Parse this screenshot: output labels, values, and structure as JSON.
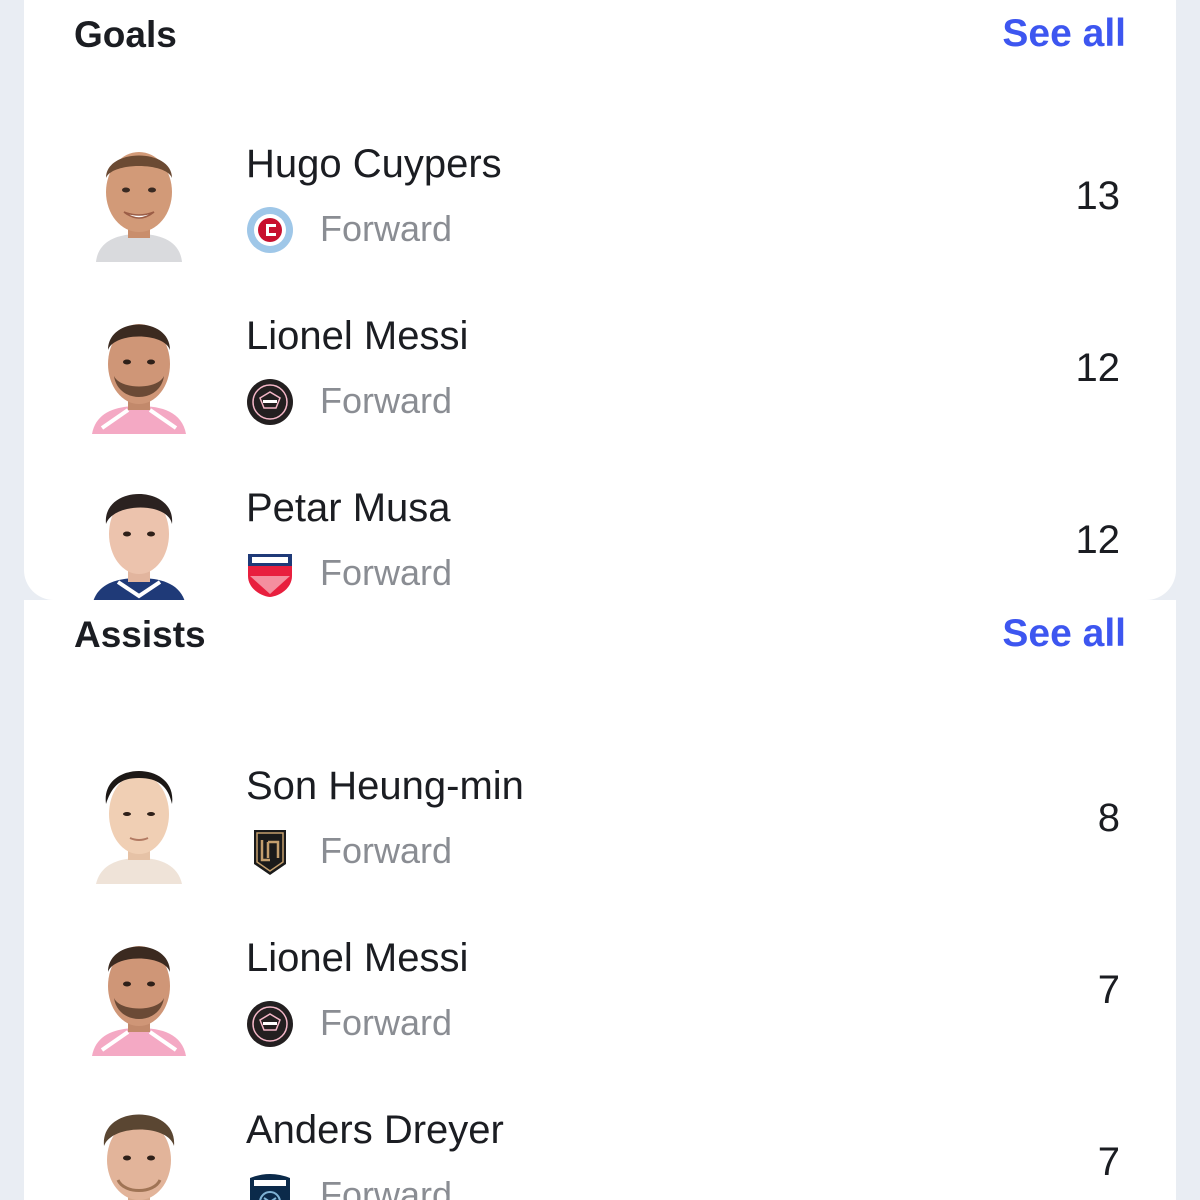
{
  "goals": {
    "title": "Goals",
    "see_all": "See all",
    "players": [
      {
        "name": "Hugo Cuypers",
        "position": "Forward",
        "value": "13",
        "club_logo": "chicago-fire-logo",
        "club_color": "#c8102e"
      },
      {
        "name": "Lionel Messi",
        "position": "Forward",
        "value": "12",
        "club_logo": "inter-miami-logo",
        "club_color": "#231f20"
      },
      {
        "name": "Petar Musa",
        "position": "Forward",
        "value": "12",
        "club_logo": "fc-dallas-logo",
        "club_color": "#e81f3e"
      }
    ]
  },
  "assists": {
    "title": "Assists",
    "see_all": "See all",
    "players": [
      {
        "name": "Son Heung-min",
        "position": "Forward",
        "value": "8",
        "club_logo": "lafc-logo",
        "club_color": "#c39e6d"
      },
      {
        "name": "Lionel Messi",
        "position": "Forward",
        "value": "7",
        "club_logo": "inter-miami-logo",
        "club_color": "#231f20"
      },
      {
        "name": "Anders Dreyer",
        "position": "Forward",
        "value": "7",
        "club_logo": "san-diego-fc-logo",
        "club_color": "#0b2a4a"
      }
    ]
  },
  "colors": {
    "accent": "#3d56f0",
    "text": "#1b1d22",
    "muted": "#8a8d93",
    "card": "#ffffff",
    "background": "#e9edf3"
  }
}
